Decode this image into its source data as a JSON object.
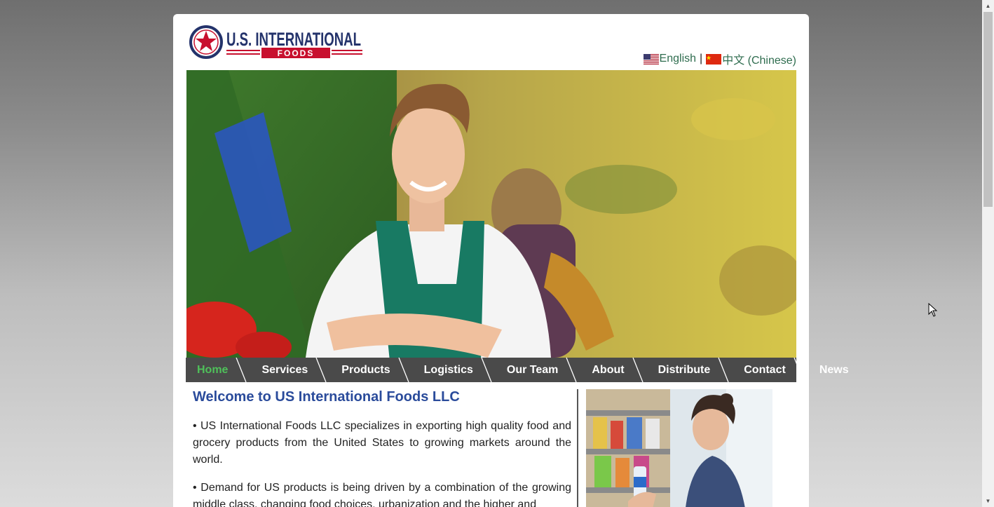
{
  "header": {
    "logo_text_top": "U.S. INTERNATIONAL",
    "logo_text_bottom": "FOODS",
    "lang_english": "English",
    "lang_separator": "|",
    "lang_chinese": "中文 (Chinese)"
  },
  "nav": {
    "items": [
      {
        "label": "Home"
      },
      {
        "label": "Services"
      },
      {
        "label": "Products"
      },
      {
        "label": "Logistics"
      },
      {
        "label": "Our Team"
      },
      {
        "label": "About"
      },
      {
        "label": "Distribute"
      },
      {
        "label": "Contact"
      },
      {
        "label": "News"
      }
    ]
  },
  "main": {
    "title": "Welcome to US International Foods LLC",
    "paragraphs": [
      "• US International Foods LLC specializes in exporting high quality food and grocery products from the United States to growing markets around the world.",
      "• Demand for US products is being driven by a combination of the growing middle class, changing food choices, urbanization and the higher and"
    ]
  },
  "colors": {
    "brand_blue": "#2a4b9b",
    "brand_red": "#c8102e",
    "nav_bg": "#4a4a4a",
    "nav_active": "#4fc05a",
    "lang_link": "#2f6d4f"
  },
  "icons": {
    "us_flag": "us-flag-icon",
    "cn_flag": "china-flag-icon",
    "star": "star-icon"
  }
}
